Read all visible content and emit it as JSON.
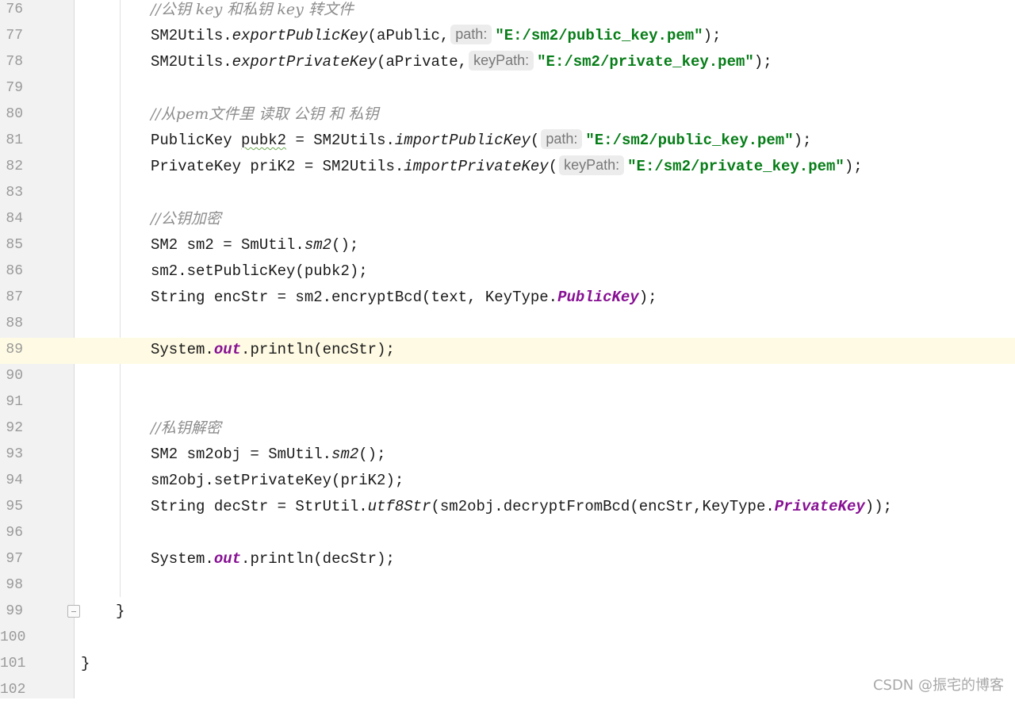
{
  "line_numbers": [
    "76",
    "77",
    "78",
    "79",
    "80",
    "81",
    "82",
    "83",
    "84",
    "85",
    "86",
    "87",
    "88",
    "89",
    "90",
    "91",
    "92",
    "93",
    "94",
    "95",
    "96",
    "97",
    "98",
    "99",
    "100",
    "101",
    "102"
  ],
  "code": {
    "l76_comment": "//公钥 key 和私钥 key 转文件",
    "l77_pre": "SM2Utils.",
    "l77_method": "exportPublicKey",
    "l77_args": "(aPublic,",
    "l77_hint": "path:",
    "l77_str": "\"E:/sm2/public_key.pem\"",
    "l77_end": ");",
    "l78_pre": "SM2Utils.",
    "l78_method": "exportPrivateKey",
    "l78_args": "(aPrivate,",
    "l78_hint": "keyPath:",
    "l78_str": "\"E:/sm2/private_key.pem\"",
    "l78_end": ");",
    "l80_comment": "//从pem文件里 读取 公钥 和 私钥",
    "l81_pre": "PublicKey ",
    "l81_var": "pubk2",
    "l81_mid": " = SM2Utils.",
    "l81_method": "importPublicKey",
    "l81_paren": "(",
    "l81_hint": "path:",
    "l81_str": "\"E:/sm2/public_key.pem\"",
    "l81_end": ");",
    "l82_pre": "PrivateKey priK2 = SM2Utils.",
    "l82_method": "importPrivateKey",
    "l82_paren": "(",
    "l82_hint": "keyPath:",
    "l82_str": "\"E:/sm2/private_key.pem\"",
    "l82_end": ");",
    "l84_comment": "//公钥加密",
    "l85_pre": "SM2 sm2 = SmUtil.",
    "l85_method": "sm2",
    "l85_end": "();",
    "l86_text": "sm2.setPublicKey(pubk2);",
    "l87_pre": "String encStr = sm2.encryptBcd(text, KeyType.",
    "l87_field": "PublicKey",
    "l87_end": ");",
    "l89_pre": "System.",
    "l89_field": "out",
    "l89_end": ".println(encStr);",
    "l92_comment": "//私钥解密",
    "l93_pre": "SM2 sm2obj = SmUtil.",
    "l93_method": "sm2",
    "l93_end": "();",
    "l94_text": "sm2obj.setPrivateKey(priK2);",
    "l95_pre": "String decStr = StrUtil.",
    "l95_method": "utf8Str",
    "l95_mid": "(sm2obj.decryptFromBcd(encStr,KeyType.",
    "l95_field": "PrivateKey",
    "l95_end": "));",
    "l97_pre": "System.",
    "l97_field": "out",
    "l97_end": ".println(decStr);",
    "l99_text": "}",
    "l101_text": "}"
  },
  "watermark": "CSDN @振宅的博客",
  "colors": {
    "comment": "#8c8c8c",
    "string": "#067d17",
    "static_field": "#871094",
    "current_line": "#fefae3",
    "gutter": "#f2f2f2"
  }
}
